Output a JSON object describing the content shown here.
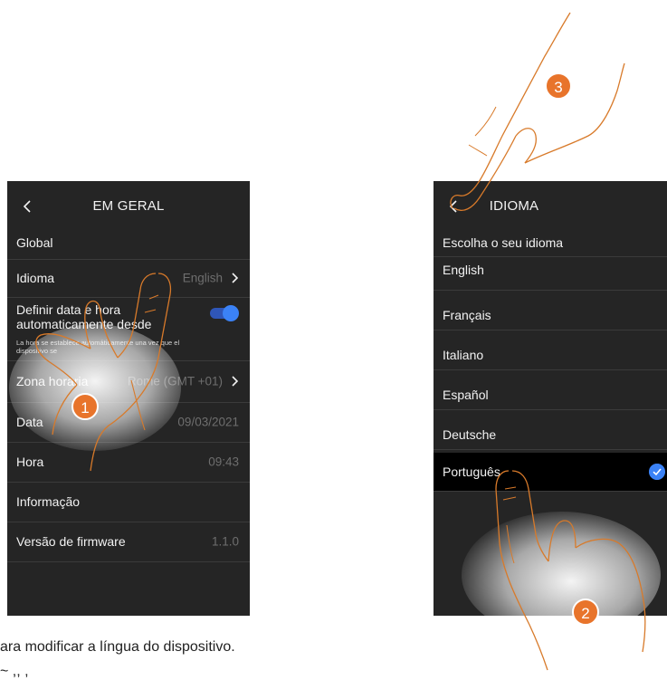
{
  "left_screen": {
    "title": "EM GERAL",
    "section": "Global",
    "rows": {
      "idioma": {
        "label": "Idioma",
        "value": "English"
      },
      "auto_time": {
        "label_line1": "Definir data e hora",
        "label_line2": "automaticamente desde",
        "sub_line1": "La hora se establece automáticamente una vez que el",
        "sub_line2": "dispositivo se"
      },
      "timezone": {
        "label": "Zona horaria",
        "value": "Rome (GMT +01)"
      },
      "data": {
        "label": "Data",
        "value": "09/03/2021"
      },
      "hora": {
        "label": "Hora",
        "value": "09:43"
      },
      "info": {
        "label": "Informação"
      },
      "firmware": {
        "label": "Versão de firmware",
        "value": "1.1.0"
      }
    }
  },
  "right_screen": {
    "title": "IDIOMA",
    "subtitle": "Escolha o seu idioma",
    "languages": [
      "English",
      "Français",
      "Italiano",
      "Español",
      "Deutsche",
      "Português"
    ],
    "selected_language": "Português"
  },
  "badges": [
    "1",
    "2",
    "3"
  ],
  "caption": {
    "line1": "ara modificar a língua do dispositivo.",
    "line2": "~ ,, ,"
  },
  "colors": {
    "screen_bg": "#252525",
    "accent_blue": "#3b82f6",
    "badge_orange": "#e8742b",
    "hand_stroke": "#d87a2a"
  },
  "icons": [
    "back-icon",
    "chevron-right-icon",
    "toggle-switch",
    "check-icon",
    "hand-pointer-icon"
  ]
}
